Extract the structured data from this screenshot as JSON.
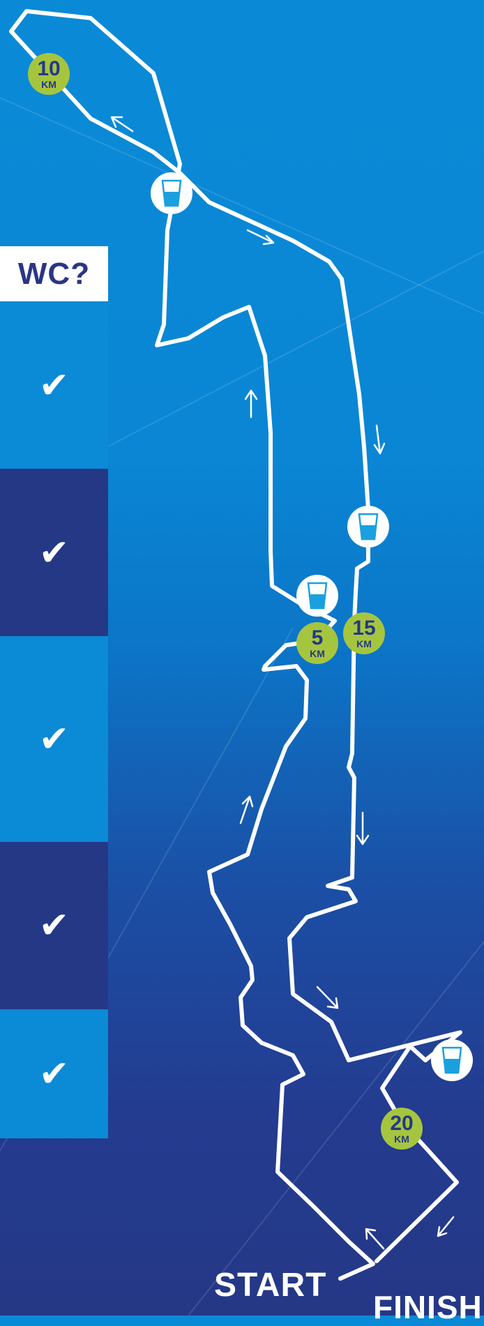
{
  "legend": {
    "header": "WC?",
    "rows": [
      {
        "mark": "✔",
        "color": "#0b8ad6"
      },
      {
        "mark": "✔",
        "color": "#253886"
      },
      {
        "mark": "✔",
        "color": "#0b8ad6"
      },
      {
        "mark": "✔",
        "color": "#253886"
      },
      {
        "mark": "✔",
        "color": "#0b8ad6"
      }
    ]
  },
  "markers": {
    "km": [
      {
        "num": "10",
        "unit": "KM"
      },
      {
        "num": "5",
        "unit": "KM"
      },
      {
        "num": "15",
        "unit": "KM"
      },
      {
        "num": "20",
        "unit": "KM"
      }
    ],
    "water_icon": "water-cup-icon",
    "direction_icon": "direction-arrow-icon"
  },
  "labels": {
    "start": "START",
    "finish": "FINISH"
  },
  "colors": {
    "km_badge": "#a6c53f",
    "km_text": "#253886",
    "route": "#ffffff",
    "water": "#1aa0df"
  }
}
